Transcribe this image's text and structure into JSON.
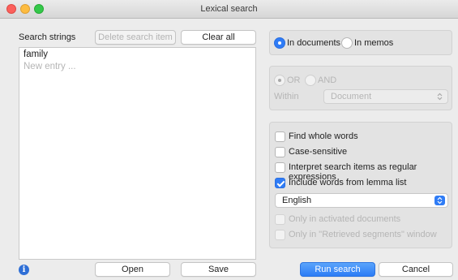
{
  "window": {
    "title": "Lexical search"
  },
  "left": {
    "heading": "Search strings",
    "delete_label": "Delete search item",
    "clear_label": "Clear all",
    "entries": [
      "family"
    ],
    "new_entry_placeholder": "New entry ...",
    "open_label": "Open",
    "save_label": "Save"
  },
  "scope": {
    "in_documents": "In documents",
    "in_memos": "In memos",
    "selected": "In documents"
  },
  "logic": {
    "or_label": "OR",
    "and_label": "AND",
    "within_label": "Within",
    "within_value": "Document"
  },
  "options": {
    "find_whole_words": {
      "label": "Find whole words",
      "checked": false
    },
    "case_sensitive": {
      "label": "Case-sensitive",
      "checked": false
    },
    "regex": {
      "label": "Interpret search items as regular expressions",
      "checked": false
    },
    "lemma": {
      "label": "Include words from lemma list",
      "checked": true
    },
    "language_value": "English",
    "only_activated": {
      "label": "Only in activated documents",
      "checked": false
    },
    "only_retrieved": {
      "label": "Only in \"Retrieved segments\" window",
      "checked": false
    }
  },
  "footer": {
    "run_label": "Run search",
    "cancel_label": "Cancel"
  },
  "colors": {
    "accent": "#2f7cf6",
    "info_icon": "#2f6fd6"
  },
  "icons": {
    "info": "info-icon",
    "select_arrows": "updown-chevron-icon"
  }
}
